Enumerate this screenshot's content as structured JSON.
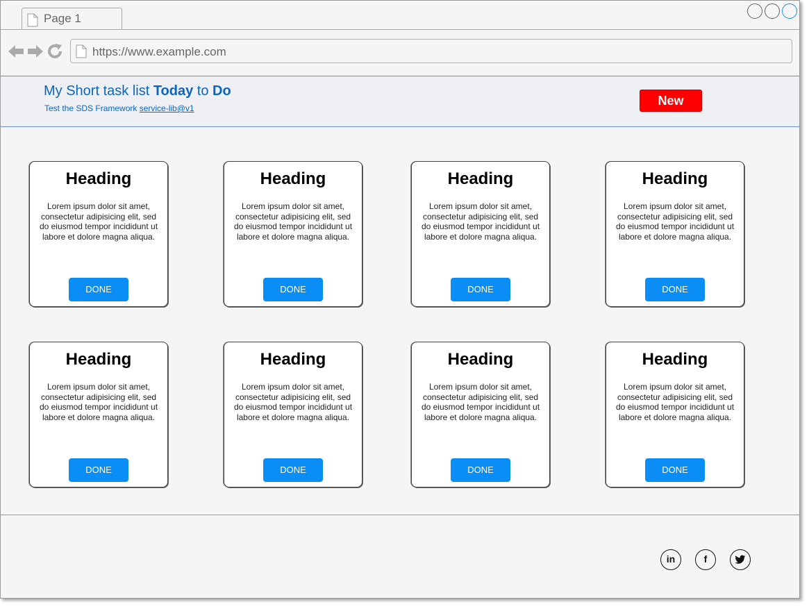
{
  "browser": {
    "tab_title": "Page 1",
    "url": "https://www.example.com"
  },
  "header": {
    "title_part1": "My Short task list ",
    "title_bold1": "Today",
    "title_part2": " to ",
    "title_bold2": "Do",
    "subtitle_text": "Test the SDS Framework ",
    "subtitle_link": "service-lib@v1",
    "new_button_label": "New"
  },
  "cards": [
    {
      "heading": "Heading",
      "text": "Lorem ipsum dolor sit amet, consectetur adipisicing elit, sed do eiusmod tempor incididunt ut labore et dolore magna aliqua.",
      "button": "DONE"
    },
    {
      "heading": "Heading",
      "text": "Lorem ipsum dolor sit amet, consectetur adipisicing elit, sed do eiusmod tempor incididunt ut labore et dolore magna aliqua.",
      "button": "DONE"
    },
    {
      "heading": "Heading",
      "text": "Lorem ipsum dolor sit amet, consectetur adipisicing elit, sed do eiusmod tempor incididunt ut labore et dolore magna aliqua.",
      "button": "DONE"
    },
    {
      "heading": "Heading",
      "text": "Lorem ipsum dolor sit amet, consectetur adipisicing elit, sed do eiusmod tempor incididunt ut labore et dolore magna aliqua.",
      "button": "DONE"
    },
    {
      "heading": "Heading",
      "text": "Lorem ipsum dolor sit amet, consectetur adipisicing elit, sed do eiusmod tempor incididunt ut labore et dolore magna aliqua.",
      "button": "DONE"
    },
    {
      "heading": "Heading",
      "text": "Lorem ipsum dolor sit amet, consectetur adipisicing elit, sed do eiusmod tempor incididunt ut labore et dolore magna aliqua.",
      "button": "DONE"
    },
    {
      "heading": "Heading",
      "text": "Lorem ipsum dolor sit amet, consectetur adipisicing elit, sed do eiusmod tempor incididunt ut labore et dolore magna aliqua.",
      "button": "DONE"
    },
    {
      "heading": "Heading",
      "text": "Lorem ipsum dolor sit amet, consectetur adipisicing elit, sed do eiusmod tempor incididunt ut labore et dolore magna aliqua.",
      "button": "DONE"
    }
  ],
  "footer": {
    "social_icons": [
      "linkedin-icon",
      "facebook-icon",
      "twitter-icon"
    ]
  },
  "colors": {
    "accent_blue": "#0b66c2",
    "done_button": "#0a8df5",
    "new_button": "#ff0000"
  }
}
